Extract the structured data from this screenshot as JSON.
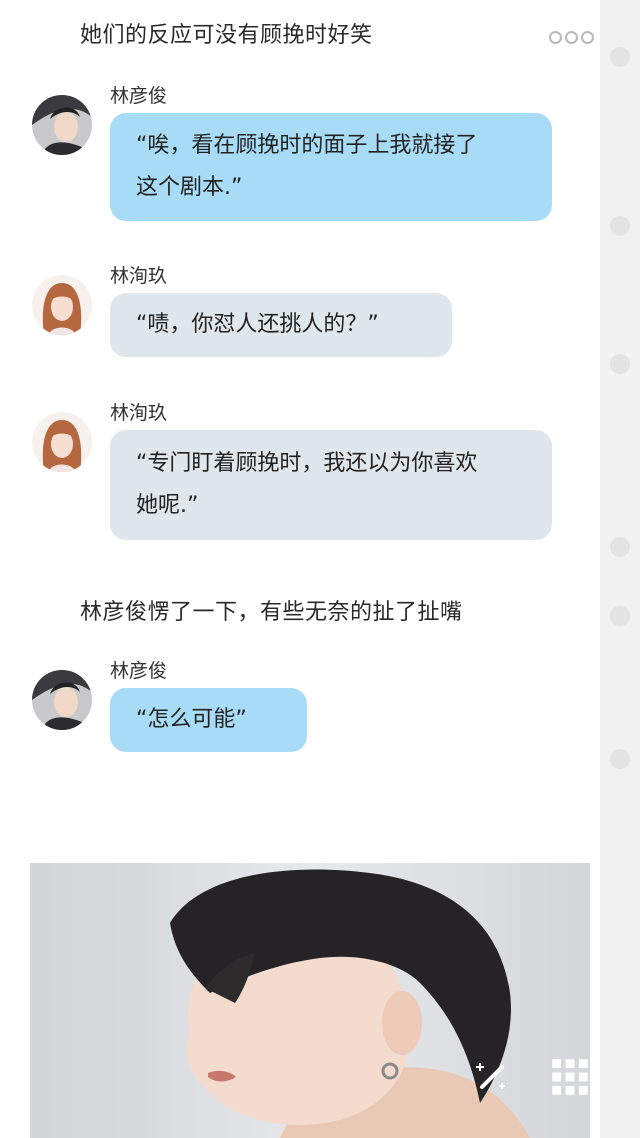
{
  "narration_top": "她们的反应可没有顾挽时好笑",
  "narration_mid": "林彦俊愣了一下，有些无奈的扯了扯嘴",
  "messages": [
    {
      "name": "林彦俊",
      "text_lines": [
        "“唉，看在顾挽时的面子上我就接了",
        "这个剧本.”"
      ],
      "style": "blue"
    },
    {
      "name": "林洵玖",
      "text_lines": [
        "“啧，你怼人还挑人的？”"
      ],
      "style": "gray"
    },
    {
      "name": "林洵玖",
      "text_lines": [
        "“专门盯着顾挽时，我还以为你喜欢",
        "她呢.”"
      ],
      "style": "gray"
    },
    {
      "name": "林彦俊",
      "text_lines": [
        "“怎么可能”"
      ],
      "style": "blue"
    }
  ],
  "icons": {
    "more": "more-dots-icon",
    "edit": "magic-wand-icon",
    "grid": "grid-icon"
  },
  "colors": {
    "blue_bubble": "#a8dcf6",
    "gray_bubble": "#dfe6ec"
  }
}
